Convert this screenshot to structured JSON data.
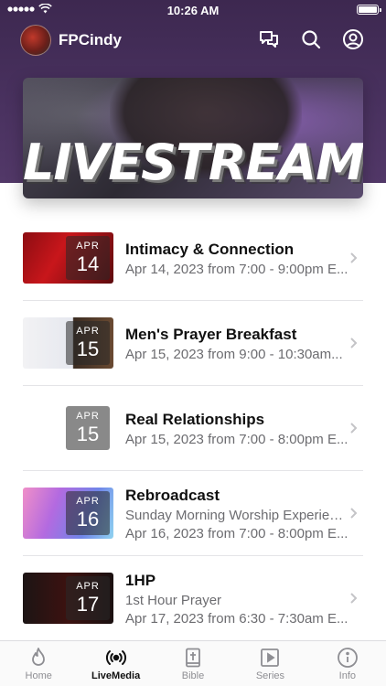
{
  "status": {
    "time": "10:26 AM"
  },
  "header": {
    "brand": "FPCindy"
  },
  "hero": {
    "title": "LIVESTREAMS"
  },
  "events": [
    {
      "month": "APR",
      "day": "14",
      "title": "Intimacy & Connection",
      "lines": [
        "Apr 14, 2023 from 7:00 - 9:00pm E..."
      ]
    },
    {
      "month": "APR",
      "day": "15",
      "title": "Men's Prayer Breakfast",
      "lines": [
        "Apr 15, 2023 from 9:00 - 10:30am..."
      ]
    },
    {
      "month": "APR",
      "day": "15",
      "title": "Real Relationships",
      "lines": [
        "Apr 15, 2023 from 7:00 - 8:00pm E..."
      ]
    },
    {
      "month": "APR",
      "day": "16",
      "title": "Rebroadcast",
      "lines": [
        "Sunday Morning Worship Experience",
        "Apr 16, 2023 from 7:00 - 8:00pm E..."
      ]
    },
    {
      "month": "APR",
      "day": "17",
      "title": "1HP",
      "lines": [
        "1st Hour Prayer",
        "Apr 17, 2023 from 6:30 - 7:30am E..."
      ]
    }
  ],
  "tabs": [
    {
      "label": "Home",
      "icon": "flame-icon",
      "active": false
    },
    {
      "label": "LiveMedia",
      "icon": "broadcast-icon",
      "active": true
    },
    {
      "label": "Bible",
      "icon": "bible-icon",
      "active": false
    },
    {
      "label": "Series",
      "icon": "play-icon",
      "active": false
    },
    {
      "label": "Info",
      "icon": "info-icon",
      "active": false
    }
  ],
  "colors": {
    "header": "#4a3260",
    "accent": "#111111",
    "inactive_tab": "#8e8e93"
  }
}
